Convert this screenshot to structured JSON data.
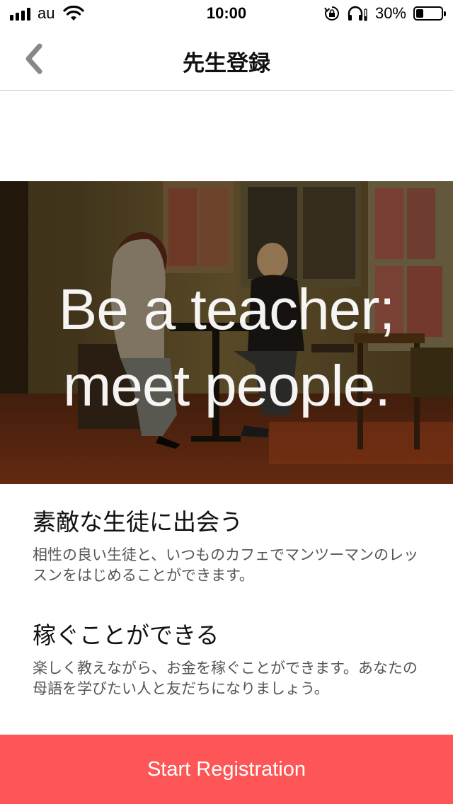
{
  "status_bar": {
    "carrier": "au",
    "time": "10:00",
    "battery_percent": "30%",
    "battery_level": 0.3,
    "icons": [
      "signal-icon",
      "wifi-icon",
      "orientation-lock-icon",
      "headphones-icon",
      "battery-icon"
    ]
  },
  "nav": {
    "title": "先生登録",
    "back_icon": "chevron-left-icon"
  },
  "hero": {
    "line1": "Be a teacher;",
    "line2": "meet people."
  },
  "features": [
    {
      "title": "素敵な生徒に出会う",
      "description": "相性の良い生徒と、いつものカフェでマンツーマンのレッスンをはじめることができます。"
    },
    {
      "title": "稼ぐことができる",
      "description": "楽しく教えながら、お金を稼ぐことができます。あなたの母語を学びたい人と友だちになりましょう。"
    }
  ],
  "cta": {
    "label": "Start Registration"
  },
  "colors": {
    "accent": "#fe5656",
    "title_text": "#111111",
    "desc_text": "#555555"
  }
}
